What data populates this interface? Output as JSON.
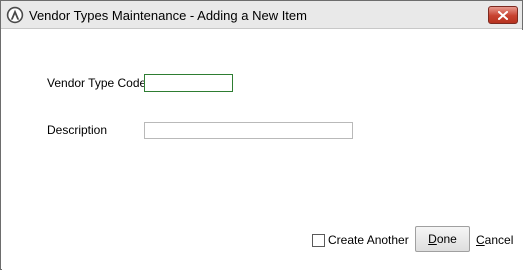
{
  "window": {
    "title": "Vendor Types Maintenance - Adding a New Item",
    "app_icon": "app-logo-icon",
    "close_icon": "close-icon"
  },
  "form": {
    "vendor_type_code_label": "Vendor Type Code",
    "vendor_type_code_value": "",
    "description_label": "Description",
    "description_value": ""
  },
  "footer": {
    "create_another_label": "Create Another",
    "create_another_checked": false,
    "done_label": "Done",
    "cancel_label": "Cancel"
  },
  "colors": {
    "close_button": "#c7412f",
    "focused_field_border": "#2e7d32",
    "titlebar": "#e9e9e9"
  }
}
